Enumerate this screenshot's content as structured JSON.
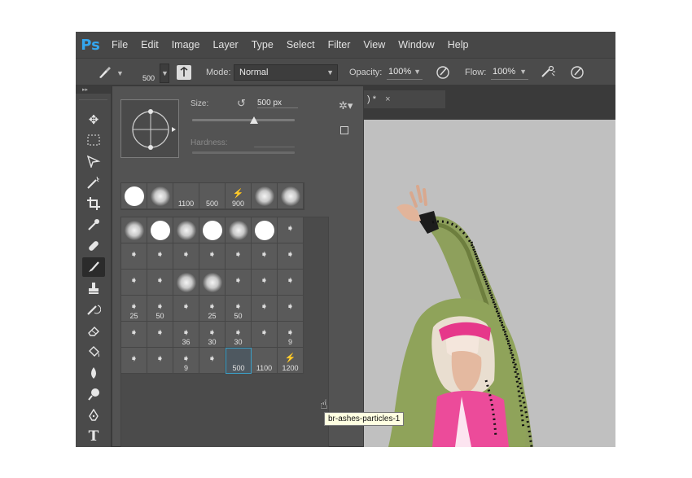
{
  "app": {
    "logo": "Ps"
  },
  "menu": [
    "File",
    "Edit",
    "Image",
    "Layer",
    "Type",
    "Select",
    "Filter",
    "View",
    "Window",
    "Help"
  ],
  "options_bar": {
    "brush_size": "500",
    "mode_label": "Mode:",
    "mode_value": "Normal",
    "opacity_label": "Opacity:",
    "opacity_value": "100%",
    "flow_label": "Flow:",
    "flow_value": "100%"
  },
  "document_tab": {
    "title": ") *",
    "close": "×"
  },
  "brush_panel": {
    "size_label": "Size:",
    "size_value": "500 px",
    "size_fraction": 0.6,
    "hardness_label": "Hardness:",
    "recent": [
      {
        "kind": "hard",
        "size": ""
      },
      {
        "kind": "soft",
        "size": ""
      },
      {
        "kind": "empty",
        "size": "1100"
      },
      {
        "kind": "empty",
        "size": "500"
      },
      {
        "kind": "particle",
        "size": "900"
      },
      {
        "kind": "soft",
        "size": ""
      },
      {
        "kind": "soft",
        "size": ""
      }
    ],
    "grid_rows": [
      [
        {
          "kind": "soft",
          "size": ""
        },
        {
          "kind": "hard",
          "size": ""
        },
        {
          "kind": "soft",
          "size": ""
        },
        {
          "kind": "hard",
          "size": ""
        },
        {
          "kind": "soft",
          "size": ""
        },
        {
          "kind": "hard",
          "size": ""
        },
        {
          "kind": "stroke",
          "size": ""
        }
      ],
      [
        {
          "kind": "stroke",
          "size": ""
        },
        {
          "kind": "stroke",
          "size": ""
        },
        {
          "kind": "stroke",
          "size": ""
        },
        {
          "kind": "stroke",
          "size": ""
        },
        {
          "kind": "stroke",
          "size": ""
        },
        {
          "kind": "stroke",
          "size": ""
        },
        {
          "kind": "stroke",
          "size": ""
        }
      ],
      [
        {
          "kind": "stroke",
          "size": ""
        },
        {
          "kind": "stroke",
          "size": ""
        },
        {
          "kind": "soft",
          "size": ""
        },
        {
          "kind": "soft",
          "size": ""
        },
        {
          "kind": "stroke",
          "size": ""
        },
        {
          "kind": "stroke",
          "size": ""
        },
        {
          "kind": "stroke",
          "size": ""
        }
      ],
      [
        {
          "kind": "stroke",
          "size": "25"
        },
        {
          "kind": "stroke",
          "size": "50"
        },
        {
          "kind": "stroke",
          "size": ""
        },
        {
          "kind": "stroke",
          "size": "25"
        },
        {
          "kind": "stroke",
          "size": "50"
        },
        {
          "kind": "stroke",
          "size": ""
        },
        {
          "kind": "stroke",
          "size": ""
        }
      ],
      [
        {
          "kind": "stroke",
          "size": ""
        },
        {
          "kind": "stroke",
          "size": ""
        },
        {
          "kind": "stroke",
          "size": "36"
        },
        {
          "kind": "stroke",
          "size": "30"
        },
        {
          "kind": "stroke",
          "size": "30"
        },
        {
          "kind": "stroke",
          "size": ""
        },
        {
          "kind": "stroke",
          "size": "9"
        }
      ],
      [
        {
          "kind": "stroke",
          "size": ""
        },
        {
          "kind": "stroke",
          "size": ""
        },
        {
          "kind": "stroke",
          "size": "9"
        },
        {
          "kind": "stroke",
          "size": ""
        },
        {
          "kind": "selected",
          "size": "500"
        },
        {
          "kind": "empty",
          "size": "1100"
        },
        {
          "kind": "particle",
          "size": "1200"
        }
      ]
    ],
    "tooltip": "br-ashes-particles-1"
  },
  "tools": [
    "move-icon",
    "marquee-icon",
    "lasso-icon",
    "magic-wand-icon",
    "crop-icon",
    "eyedropper-icon",
    "healing-icon",
    "brush-icon",
    "stamp-icon",
    "history-brush-icon",
    "eraser-icon",
    "paint-bucket-icon",
    "blur-icon",
    "dodge-icon",
    "pen-icon",
    "type-icon"
  ],
  "active_tool": "brush-icon"
}
